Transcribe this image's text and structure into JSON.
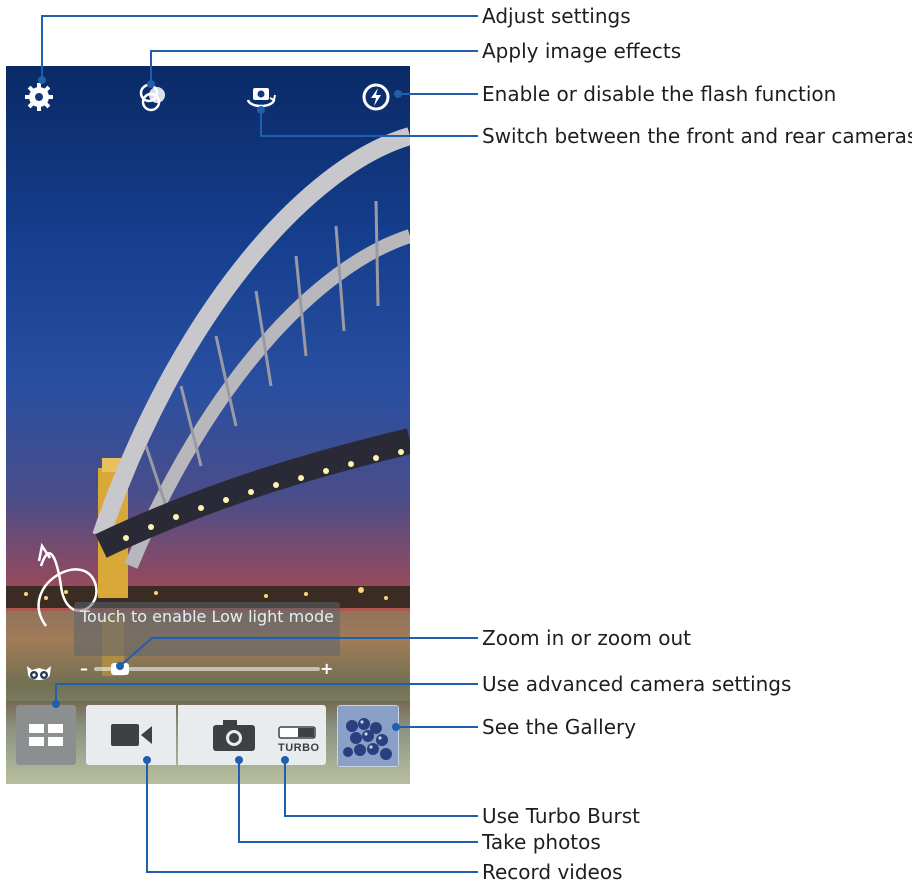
{
  "camera": {
    "low_light_hint": "Touch to enable Low light mode",
    "zoom": {
      "minus": "–",
      "plus": "+",
      "level": 0.08
    },
    "turbo_label": "TURBO",
    "icons": [
      "gear-icon",
      "effects-icon",
      "switch-camera-icon",
      "flash-icon",
      "owl-icon",
      "mode-grid-icon",
      "video-camera-icon",
      "camera-icon",
      "turbo-toggle-icon",
      "gallery-thumbnail"
    ]
  },
  "callouts": {
    "settings": "Adjust settings",
    "effects": "Apply image effects",
    "flash": "Enable or disable the flash function",
    "switch_camera": "Switch between the front and rear cameras",
    "zoom": "Zoom in or zoom out",
    "advanced": "Use advanced camera settings",
    "gallery": "See the Gallery",
    "turbo": "Use Turbo Burst",
    "photo": "Take photos",
    "video": "Record videos"
  },
  "colors": {
    "callout_line": "#1f5fae",
    "bar_tile": "#e9ecee",
    "mode_tile": "#8c8f90"
  }
}
